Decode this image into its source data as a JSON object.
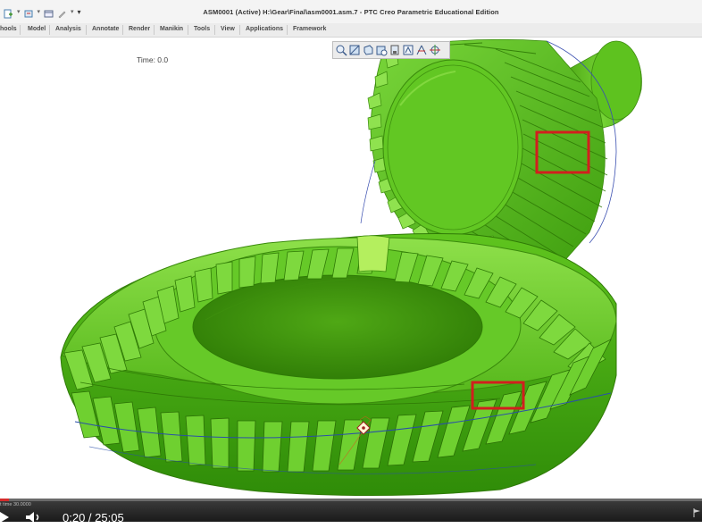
{
  "window": {
    "title": "ASM0001 (Active) H:\\Gear\\Final\\asm0001.asm.7 - PTC Creo Parametric Educational Edition"
  },
  "menu": {
    "tabs": [
      "hools",
      "Model",
      "Analysis",
      "Annotate",
      "Render",
      "Manikin",
      "Tools",
      "View",
      "Applications",
      "Framework"
    ]
  },
  "viewport": {
    "time_label": "Time: 0.0",
    "status_text": "t time 30.0000"
  },
  "graphics_toolbar": {
    "icons": [
      "zoom-in-icon",
      "zoom-out-icon",
      "refit-icon",
      "repaint-icon",
      "display-style-icon",
      "saved-views-icon",
      "datum-display-icon",
      "spin-center-icon"
    ]
  },
  "player": {
    "time_display": "0:20 / 25:05",
    "progress": 0.013
  },
  "colors": {
    "gear_green": "#5cc61d",
    "highlight_box": "#d21e1e",
    "accent": "#d52c2c"
  }
}
